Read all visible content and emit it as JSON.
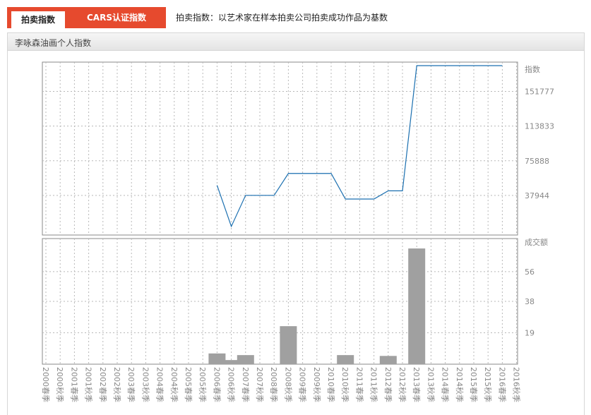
{
  "tabs": {
    "auction_index": "拍卖指数",
    "cars_index": "CARS认证指数"
  },
  "description": "拍卖指数：以艺术家在样本拍卖公司拍卖成功作品为基数",
  "panel_title": "李咏森油画个人指数",
  "colors": {
    "accent": "#e64a2e",
    "line": "#1a6fb0",
    "bar": "#a0a0a0"
  },
  "chart_data": [
    {
      "type": "line",
      "ylabel": "指数",
      "y_ticks": [
        37944,
        75888,
        113833,
        151777
      ],
      "x": [
        "2000春季",
        "2000秋季",
        "2001春季",
        "2001秋季",
        "2002春季",
        "2002秋季",
        "2003春季",
        "2003秋季",
        "2004春季",
        "2004秋季",
        "2005春季",
        "2005秋季",
        "2006春季",
        "2006秋季",
        "2007春季",
        "2007秋季",
        "2008春季",
        "2008秋季",
        "2009春季",
        "2009秋季",
        "2010春季",
        "2010秋季",
        "2011春季",
        "2011秋季",
        "2012春季",
        "2012秋季",
        "2013春季",
        "2013秋季",
        "2014春季",
        "2014秋季",
        "2015春季",
        "2015秋季",
        "2016春季",
        "2016秋季"
      ],
      "values": [
        null,
        null,
        null,
        null,
        null,
        null,
        null,
        null,
        null,
        null,
        null,
        null,
        49000,
        4000,
        38000,
        38000,
        38000,
        62000,
        62000,
        62000,
        62000,
        34000,
        34000,
        34000,
        43000,
        43000,
        180000,
        180000,
        180000,
        180000,
        180000,
        180000,
        180000,
        null
      ]
    },
    {
      "type": "bar",
      "ylabel": "成交额",
      "y_ticks": [
        19,
        38,
        56
      ],
      "x": [
        "2000春季",
        "2000秋季",
        "2001春季",
        "2001秋季",
        "2002春季",
        "2002秋季",
        "2003春季",
        "2003秋季",
        "2004春季",
        "2004秋季",
        "2005春季",
        "2005秋季",
        "2006春季",
        "2006秋季",
        "2007春季",
        "2007秋季",
        "2008春季",
        "2008秋季",
        "2009春季",
        "2009秋季",
        "2010春季",
        "2010秋季",
        "2011春季",
        "2011秋季",
        "2012春季",
        "2012秋季",
        "2013春季",
        "2013秋季",
        "2014春季",
        "2014秋季",
        "2015春季",
        "2015秋季",
        "2016春季",
        "2016秋季"
      ],
      "values": [
        0,
        0,
        0,
        0,
        0,
        0,
        0,
        0,
        0,
        0,
        0,
        0,
        6.5,
        2.5,
        5.5,
        0,
        0,
        23,
        0,
        0,
        0,
        5.5,
        0,
        0,
        5,
        0,
        70,
        0,
        0,
        0,
        0,
        0,
        0,
        0
      ]
    }
  ]
}
